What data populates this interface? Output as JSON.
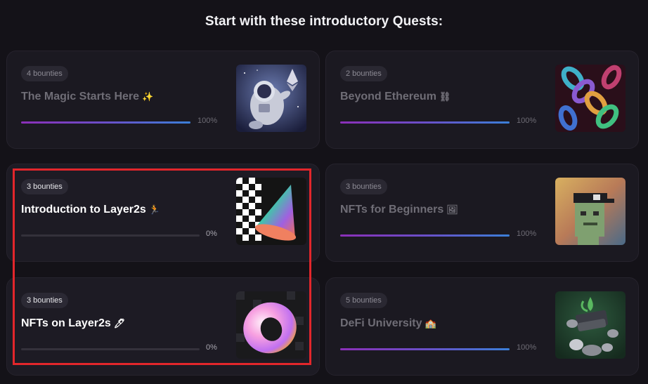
{
  "page": {
    "title": "Start with these introductory Quests:"
  },
  "quests": [
    {
      "bounties": "4 bounties",
      "title": "The Magic Starts Here",
      "emoji": "✨",
      "progress_label": "100%",
      "progress": 1.0,
      "image": "astronaut-ethereum-image"
    },
    {
      "bounties": "2 bounties",
      "title": "Beyond Ethereum",
      "emoji": "⛓",
      "progress_label": "100%",
      "progress": 1.0,
      "image": "chains-image"
    },
    {
      "bounties": "3 bounties",
      "title": "Introduction to Layer2s",
      "emoji": "🏃",
      "progress_label": "0%",
      "progress": 0.0,
      "image": "checkered-cone-image"
    },
    {
      "bounties": "3 bounties",
      "title": "NFTs for Beginners",
      "emoji": "🖼",
      "progress_label": "100%",
      "progress": 1.0,
      "image": "pixel-punk-image"
    },
    {
      "bounties": "3 bounties",
      "title": "NFTs on Layer2s",
      "emoji": "🖊",
      "progress_label": "0%",
      "progress": 0.0,
      "image": "torus-image"
    },
    {
      "bounties": "5 bounties",
      "title": "DeFi University",
      "emoji": "🏫",
      "progress_label": "100%",
      "progress": 1.0,
      "image": "defi-coins-image"
    }
  ],
  "colors": {
    "background": "#141218",
    "card": "#1b1921",
    "highlight": "#e2262b",
    "progress_start": "#8b2fb8",
    "progress_end": "#3b7fd8"
  }
}
